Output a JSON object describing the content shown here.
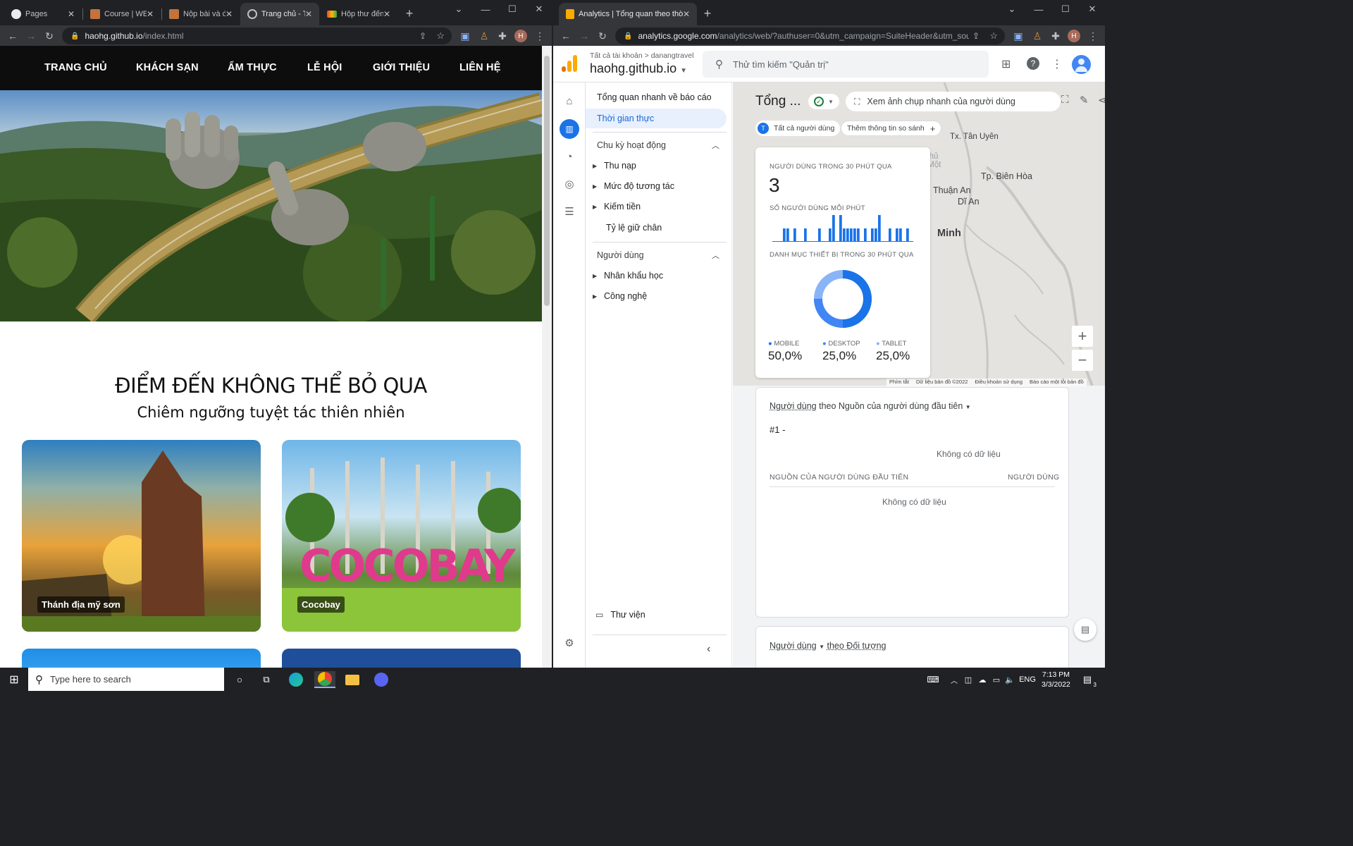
{
  "left_browser": {
    "tabs": [
      {
        "label": "Pages",
        "icon": "github-icon"
      },
      {
        "label": "Course | WEB",
        "icon": "course-icon"
      },
      {
        "label": "Nộp bài và đi",
        "icon": "course-icon"
      },
      {
        "label": "Trang chủ - Tr",
        "icon": "globe-icon"
      },
      {
        "label": "Hộp thư đến",
        "icon": "gmail-icon"
      }
    ],
    "url_host": "haohg.github.io",
    "url_path": "/index.html",
    "profile_initial": "H"
  },
  "site": {
    "nav": [
      "TRANG CHỦ",
      "KHÁCH SẠN",
      "ẨM THỰC",
      "LỄ HỘI",
      "GIỚI THIỆU",
      "LIÊN HỆ"
    ],
    "section_title": "ĐIỂM ĐẾN KHÔNG THỂ BỎ QUA",
    "section_subtitle": "Chiêm ngưỡng tuyệt tác thiên nhiên",
    "cards": [
      {
        "label": "Thánh địa mỹ sơn"
      },
      {
        "label": "Cocobay",
        "sign_text": "COCOBAY"
      }
    ]
  },
  "right_browser": {
    "tab_label": "Analytics | Tổng quan theo thời g",
    "url_host": "analytics.google.com",
    "url_path": "/analytics/web/?authuser=0&utm_campaign=SuiteHeader&utm_sourc...",
    "profile_initial": "H"
  },
  "ga": {
    "breadcrumb_root": "Tất cả tài khoản",
    "breadcrumb_child": "danangtravel",
    "property": "haohg.github.io",
    "search_placeholder": "Thử tìm kiếm \"Quản trị\"",
    "nav": {
      "overview": "Tổng quan nhanh về báo cáo",
      "realtime": "Thời gian thực",
      "lifecycle": "Chu kỳ hoạt động",
      "lifecycle_items": [
        "Thu nạp",
        "Mức độ tương tác",
        "Kiếm tiền",
        "Tỷ lệ giữ chân"
      ],
      "users": "Người dùng",
      "users_items": [
        "Nhân khẩu học",
        "Công nghệ"
      ],
      "library": "Thư viện"
    },
    "page_title": "Tổng ...",
    "snapshot_label": "Xem ảnh chụp nhanh của người dùng",
    "segment_initial": "T",
    "segment_label": "Tất cả người dùng",
    "add_comparison": "Thêm thông tin so sánh",
    "map_labels": [
      "Tx. Tân Uyên",
      "Tp. Thủ Dầu Một",
      "Tp. Biên Hòa",
      "Thuận An",
      "Dĩ An",
      "Minh"
    ],
    "map_footer": [
      "Phím tắt",
      "Dữ liệu bản đồ ©2022",
      "Điều khoản sử dụng",
      "Báo cáo một lỗi bản đồ"
    ],
    "realtime_card": {
      "users_30min_label": "NGƯỜI DÙNG TRONG 30 PHÚT QUA",
      "users_30min_value": "3",
      "per_minute_label": "SỐ NGƯỜI DÙNG MỖI PHÚT",
      "device_label": "DANH MỤC THIẾT BỊ TRONG 30 PHÚT QUA",
      "devices": [
        {
          "name": "MOBILE",
          "value": "50,0%",
          "color": "#1a73e8"
        },
        {
          "name": "DESKTOP",
          "value": "25,0%",
          "color": "#4285f4"
        },
        {
          "name": "TABLET",
          "value": "25,0%",
          "color": "#8ab4f8"
        }
      ]
    },
    "source_card": {
      "title_metric": "Người dùng",
      "title_rest": "theo Nguồn của người dùng đầu tiên",
      "rank": "#1  -",
      "no_data": "Không có dữ liệu",
      "col_source": "NGUỒN CỦA NGƯỜI DÙNG ĐẦU TIÊN",
      "col_users": "NGƯỜI DÙNG"
    },
    "audience_card": {
      "title_metric": "Người dùng",
      "title_rest": "theo Đối tượng"
    }
  },
  "taskbar": {
    "search_placeholder": "Type here to search",
    "lang": "ENG",
    "time": "7:13 PM",
    "date": "3/3/2022",
    "notification_count": "3"
  },
  "chart_data": {
    "type": "bar",
    "title": "SỐ NGƯỜI DÙNG MỖI PHÚT",
    "values": [
      0,
      0,
      0,
      1,
      1,
      0,
      1,
      0,
      0,
      1,
      0,
      0,
      0,
      1,
      0,
      0,
      1,
      2,
      0,
      2,
      1,
      1,
      1,
      1,
      1,
      0,
      1,
      0,
      1,
      1,
      2,
      0,
      0,
      1,
      0,
      1,
      1,
      0,
      1,
      0
    ],
    "ylim": [
      0,
      2
    ]
  }
}
